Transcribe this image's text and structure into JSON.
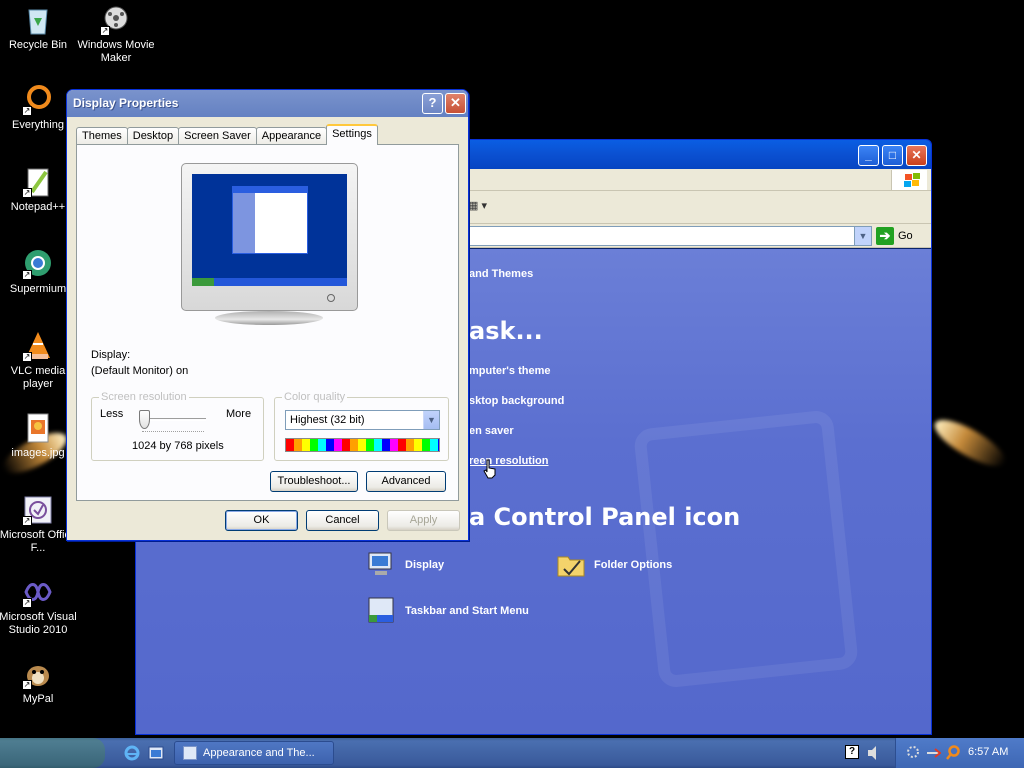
{
  "desktop": {
    "icons": [
      {
        "label": "Recycle Bin",
        "icon": "recycle-bin-icon"
      },
      {
        "label": "Windows Movie Maker",
        "icon": "movie-maker-icon"
      },
      {
        "label": "Everything",
        "icon": "everything-icon"
      },
      {
        "label": "Notepad++",
        "icon": "notepad-plus-plus-icon"
      },
      {
        "label": "Supermium",
        "icon": "supermium-icon"
      },
      {
        "label": "VLC media player",
        "icon": "vlc-icon"
      },
      {
        "label": "images.jpg",
        "icon": "image-file-icon"
      },
      {
        "label": "Microsoft Office F...",
        "icon": "office-icon"
      },
      {
        "label": "Microsoft Visual Studio 2010",
        "icon": "visual-studio-icon"
      },
      {
        "label": "MyPal",
        "icon": "mypal-icon"
      }
    ]
  },
  "control_panel": {
    "address": {
      "go_label": "Go"
    },
    "category_title": "and Themes",
    "pick_task_heading": "ask...",
    "tasks": [
      "mputer's theme",
      "sktop background",
      "en saver",
      "reen resolution"
    ],
    "pick_icon_heading": "a Control Panel icon",
    "icons": [
      {
        "label": "Display",
        "icon": "display-icon"
      },
      {
        "label": "Folder Options",
        "icon": "folder-options-icon"
      },
      {
        "label": "Taskbar and Start Menu",
        "icon": "taskbar-icon"
      }
    ]
  },
  "dialog": {
    "title": "Display Properties",
    "tabs": [
      "Themes",
      "Desktop",
      "Screen Saver",
      "Appearance",
      "Settings"
    ],
    "active_tab": "Settings",
    "display_label": "Display:",
    "display_value": "(Default Monitor) on",
    "screen_resolution": {
      "group_title": "Screen resolution",
      "less_label": "Less",
      "more_label": "More",
      "value_text": "1024 by 768 pixels",
      "slider_level": 0
    },
    "color_quality": {
      "group_title": "Color quality",
      "selected": "Highest (32 bit)"
    },
    "buttons": {
      "troubleshoot": "Troubleshoot...",
      "advanced": "Advanced",
      "ok": "OK",
      "cancel": "Cancel",
      "apply": "Apply"
    }
  },
  "taskbar": {
    "task_button": "Appearance and The...",
    "clock": "6:57 AM"
  },
  "colors": {
    "cp_background": "#5b6fd0",
    "titlebar_inactive": "#7a93cc",
    "taskbar": "#4a6fb0"
  }
}
